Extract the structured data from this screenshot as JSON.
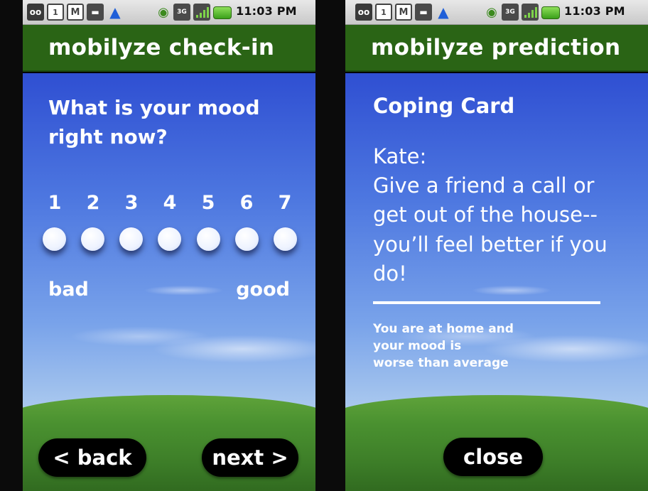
{
  "status_bar": {
    "time": "11:03 PM",
    "icons": [
      "voicemail-icon",
      "calendar-icon",
      "gmail-icon",
      "chat-icon",
      "navigation-icon",
      "sync-icon",
      "3g-icon",
      "signal-icon",
      "battery-icon"
    ],
    "calendar_text": "1",
    "network_text": "3G"
  },
  "checkin": {
    "header_title": "mobilyze check-in",
    "question": "What is your mood right now?",
    "scale": [
      "1",
      "2",
      "3",
      "4",
      "5",
      "6",
      "7"
    ],
    "low_label": "bad",
    "high_label": "good",
    "back_label": "< back",
    "next_label": "next >"
  },
  "prediction": {
    "header_title": "mobilyze prediction",
    "card_title": "Coping Card",
    "card_line1": "Kate:",
    "card_line2": "Give a friend a call or get out of the house--you’ll feel better if you do!",
    "context_line1": "You are at home and",
    "context_line2": "your mood is",
    "context_line3": "worse than average",
    "close_label": "close"
  },
  "colors": {
    "header_green": "#2a6415",
    "sky_blue": "#3b5fd8",
    "button_black": "#000000"
  }
}
